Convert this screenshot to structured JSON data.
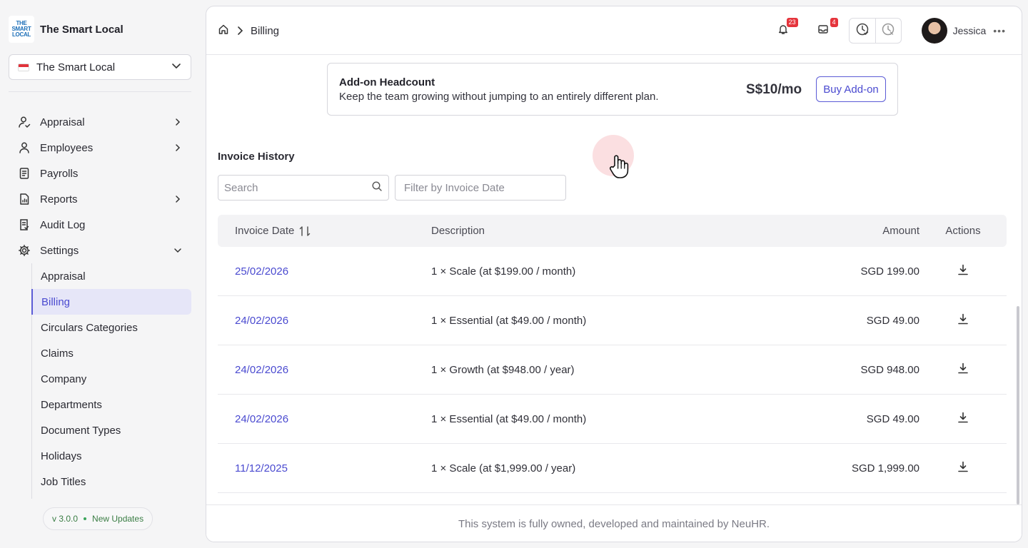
{
  "brand": {
    "name": "The Smart Local",
    "logo_lines": [
      "THE",
      "SMART",
      "LOCAL"
    ]
  },
  "org_select": {
    "value": "The Smart Local"
  },
  "nav": {
    "items": [
      {
        "label": "Appraisal",
        "icon": "user-check-icon",
        "chevron": "right"
      },
      {
        "label": "Employees",
        "icon": "user-icon",
        "chevron": "right"
      },
      {
        "label": "Payrolls",
        "icon": "receipt-icon",
        "chevron": ""
      },
      {
        "label": "Reports",
        "icon": "report-icon",
        "chevron": "right"
      },
      {
        "label": "Audit Log",
        "icon": "audit-icon",
        "chevron": ""
      },
      {
        "label": "Settings",
        "icon": "gear-icon",
        "chevron": "down"
      }
    ],
    "settings_sub": [
      "Appraisal",
      "Billing",
      "Circulars Categories",
      "Claims",
      "Company",
      "Departments",
      "Document Types",
      "Holidays",
      "Job Titles"
    ],
    "active_sub": "Billing"
  },
  "version": {
    "label": "v 3.0.0",
    "updates": "New Updates"
  },
  "breadcrumb": {
    "current": "Billing"
  },
  "topbar": {
    "notifications_count": "23",
    "messages_count": "4",
    "user_name": "Jessica"
  },
  "addon": {
    "title": "Add-on Headcount",
    "description": "Keep the team growing without jumping to an entirely different plan.",
    "price": "S$10/mo",
    "button": "Buy Add-on"
  },
  "invoice": {
    "title": "Invoice History",
    "search_placeholder": "Search",
    "date_filter_placeholder": "Filter by Invoice Date",
    "columns": {
      "date": "Invoice Date",
      "description": "Description",
      "amount": "Amount",
      "actions": "Actions"
    },
    "rows": [
      {
        "date": "25/02/2026",
        "description": "1 × Scale (at $199.00 / month)",
        "amount": "SGD 199.00"
      },
      {
        "date": "24/02/2026",
        "description": "1 × Essential (at $49.00 / month)",
        "amount": "SGD 49.00"
      },
      {
        "date": "24/02/2026",
        "description": "1 × Growth (at $948.00 / year)",
        "amount": "SGD 948.00"
      },
      {
        "date": "24/02/2026",
        "description": "1 × Essential (at $49.00 / month)",
        "amount": "SGD 49.00"
      },
      {
        "date": "11/12/2025",
        "description": "1 × Scale (at $1,999.00 / year)",
        "amount": "SGD 1,999.00"
      }
    ]
  },
  "footer": {
    "text": "This system is fully owned, developed and maintained by NeuHR."
  },
  "colors": {
    "accent": "#5b5bd6",
    "badge": "#e5343c",
    "link": "#4a4ad0"
  }
}
